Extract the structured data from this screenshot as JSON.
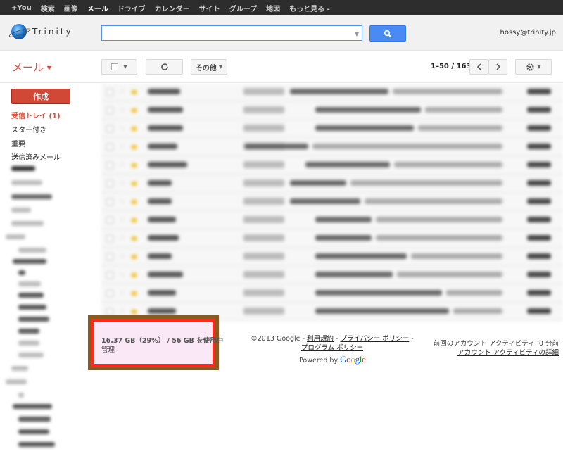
{
  "topbar": {
    "items": [
      "+You",
      "検索",
      "画像",
      "メール",
      "ドライブ",
      "カレンダー",
      "サイト",
      "グループ",
      "地図",
      "もっと見る -"
    ],
    "active_index": 3
  },
  "header": {
    "logo_text": "Trinity",
    "search_placeholder": "",
    "user_email": "hossy@trinity.jp"
  },
  "toolbar": {
    "mail_label": "メール",
    "more_label": "その他",
    "page_range": "1–50 / 163"
  },
  "sidebar": {
    "compose_label": "作成",
    "inbox_label": "受信トレイ (1)",
    "starred_label": "スター付き",
    "important_label": "重要",
    "sent_label": "送信済みメール"
  },
  "footer": {
    "storage_usage": "16.37 GB（29%） / 56 GB を使用中",
    "manage_link": "管理",
    "copyright": "©2013 Google - ",
    "terms_link": "利用規約",
    "separator": " - ",
    "privacy_link": "プライバシー ポリシー",
    "program_policy_link": "プログラム ポリシー",
    "powered_by": "Powered by",
    "google_logo": "Google",
    "last_activity": "前回のアカウント アクティビティ: 0 分前",
    "account_activity_link": "アカウント アクティビティの詳細"
  },
  "colors": {
    "accent_red": "#dd4b39",
    "search_blue": "#4a8af4",
    "highlight_box": "#ff2a1a"
  }
}
